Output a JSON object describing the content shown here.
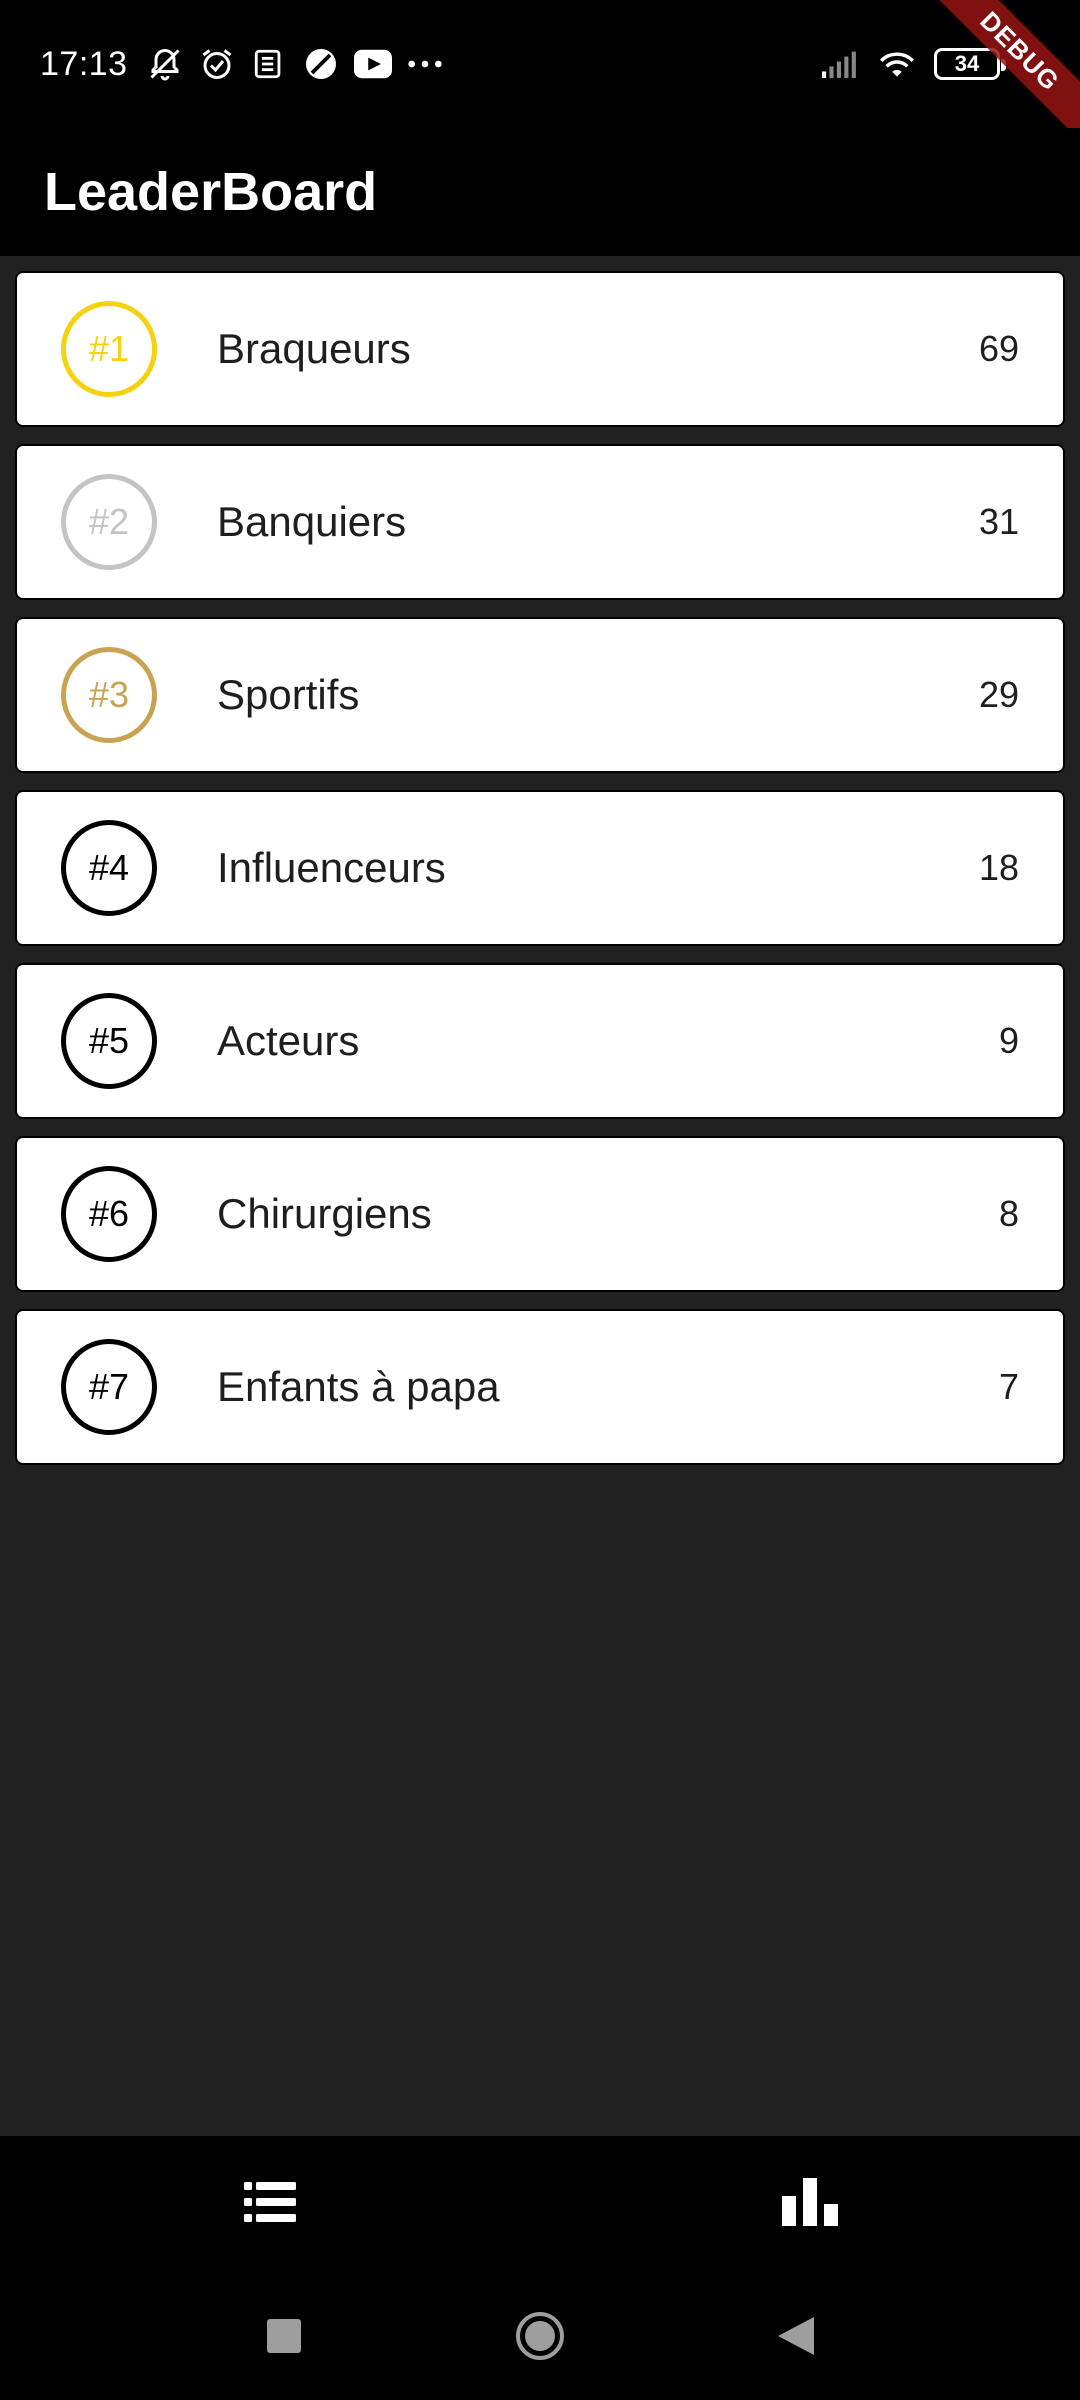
{
  "status_bar": {
    "time": "17:13",
    "battery": "34",
    "icons": [
      "bell-off-icon",
      "alarm-icon",
      "news-icon",
      "no-disturb-icon",
      "youtube-icon",
      "more-dots-icon",
      "signal-icon",
      "wifi-icon",
      "battery-icon"
    ]
  },
  "debug_ribbon": "DEBUG",
  "app_bar": {
    "title": "LeaderBoard"
  },
  "leaderboard": [
    {
      "rank": "#1",
      "name": "Braqueurs",
      "score": "69",
      "color": "#F5D20F"
    },
    {
      "rank": "#2",
      "name": "Banquiers",
      "score": "31",
      "color": "#C4C4C4"
    },
    {
      "rank": "#3",
      "name": "Sportifs",
      "score": "29",
      "color": "#C9A352"
    },
    {
      "rank": "#4",
      "name": "Influenceurs",
      "score": "18",
      "color": "#000000"
    },
    {
      "rank": "#5",
      "name": "Acteurs",
      "score": "9",
      "color": "#000000"
    },
    {
      "rank": "#6",
      "name": "Chirurgiens",
      "score": "8",
      "color": "#000000"
    },
    {
      "rank": "#7",
      "name": "Enfants à papa",
      "score": "7",
      "color": "#000000"
    }
  ],
  "bottom_nav": [
    {
      "icon": "list-icon",
      "active": true
    },
    {
      "icon": "bar-chart-icon",
      "active": false
    }
  ],
  "system_nav": [
    "recents-icon",
    "home-icon",
    "back-icon"
  ],
  "colors": {
    "background": "#212121",
    "bar": "#000000",
    "card": "#FFFFFF",
    "gold": "#F5D20F",
    "silver": "#C4C4C4",
    "bronze": "#C9A352"
  }
}
